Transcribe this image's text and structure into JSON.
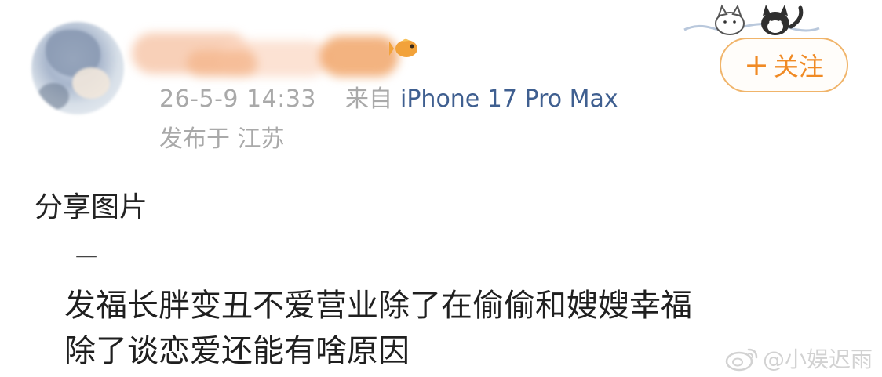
{
  "post": {
    "time": "26-5-9 14:33",
    "source_prefix": "来自",
    "device": "iPhone 17 Pro Max",
    "location": "发布于 江苏",
    "heading": "分享图片",
    "dash": "一",
    "body_line_1": "发福长胖变丑不爱营业除了在偷偷和嫂嫂幸福",
    "body_line_2": "除了谈恋爱还能有啥原因"
  },
  "actions": {
    "follow_plus": "+",
    "follow_label": "关注"
  },
  "watermark": {
    "text": "@小娱迟雨"
  },
  "colors": {
    "accent": "#f08a24",
    "link": "#3f5f90",
    "meta": "#a9a9a9"
  },
  "icons": {
    "fish": "fish-emoji-icon",
    "pets": "cat-dog-sticker-icon",
    "weibo": "weibo-logo-icon"
  }
}
